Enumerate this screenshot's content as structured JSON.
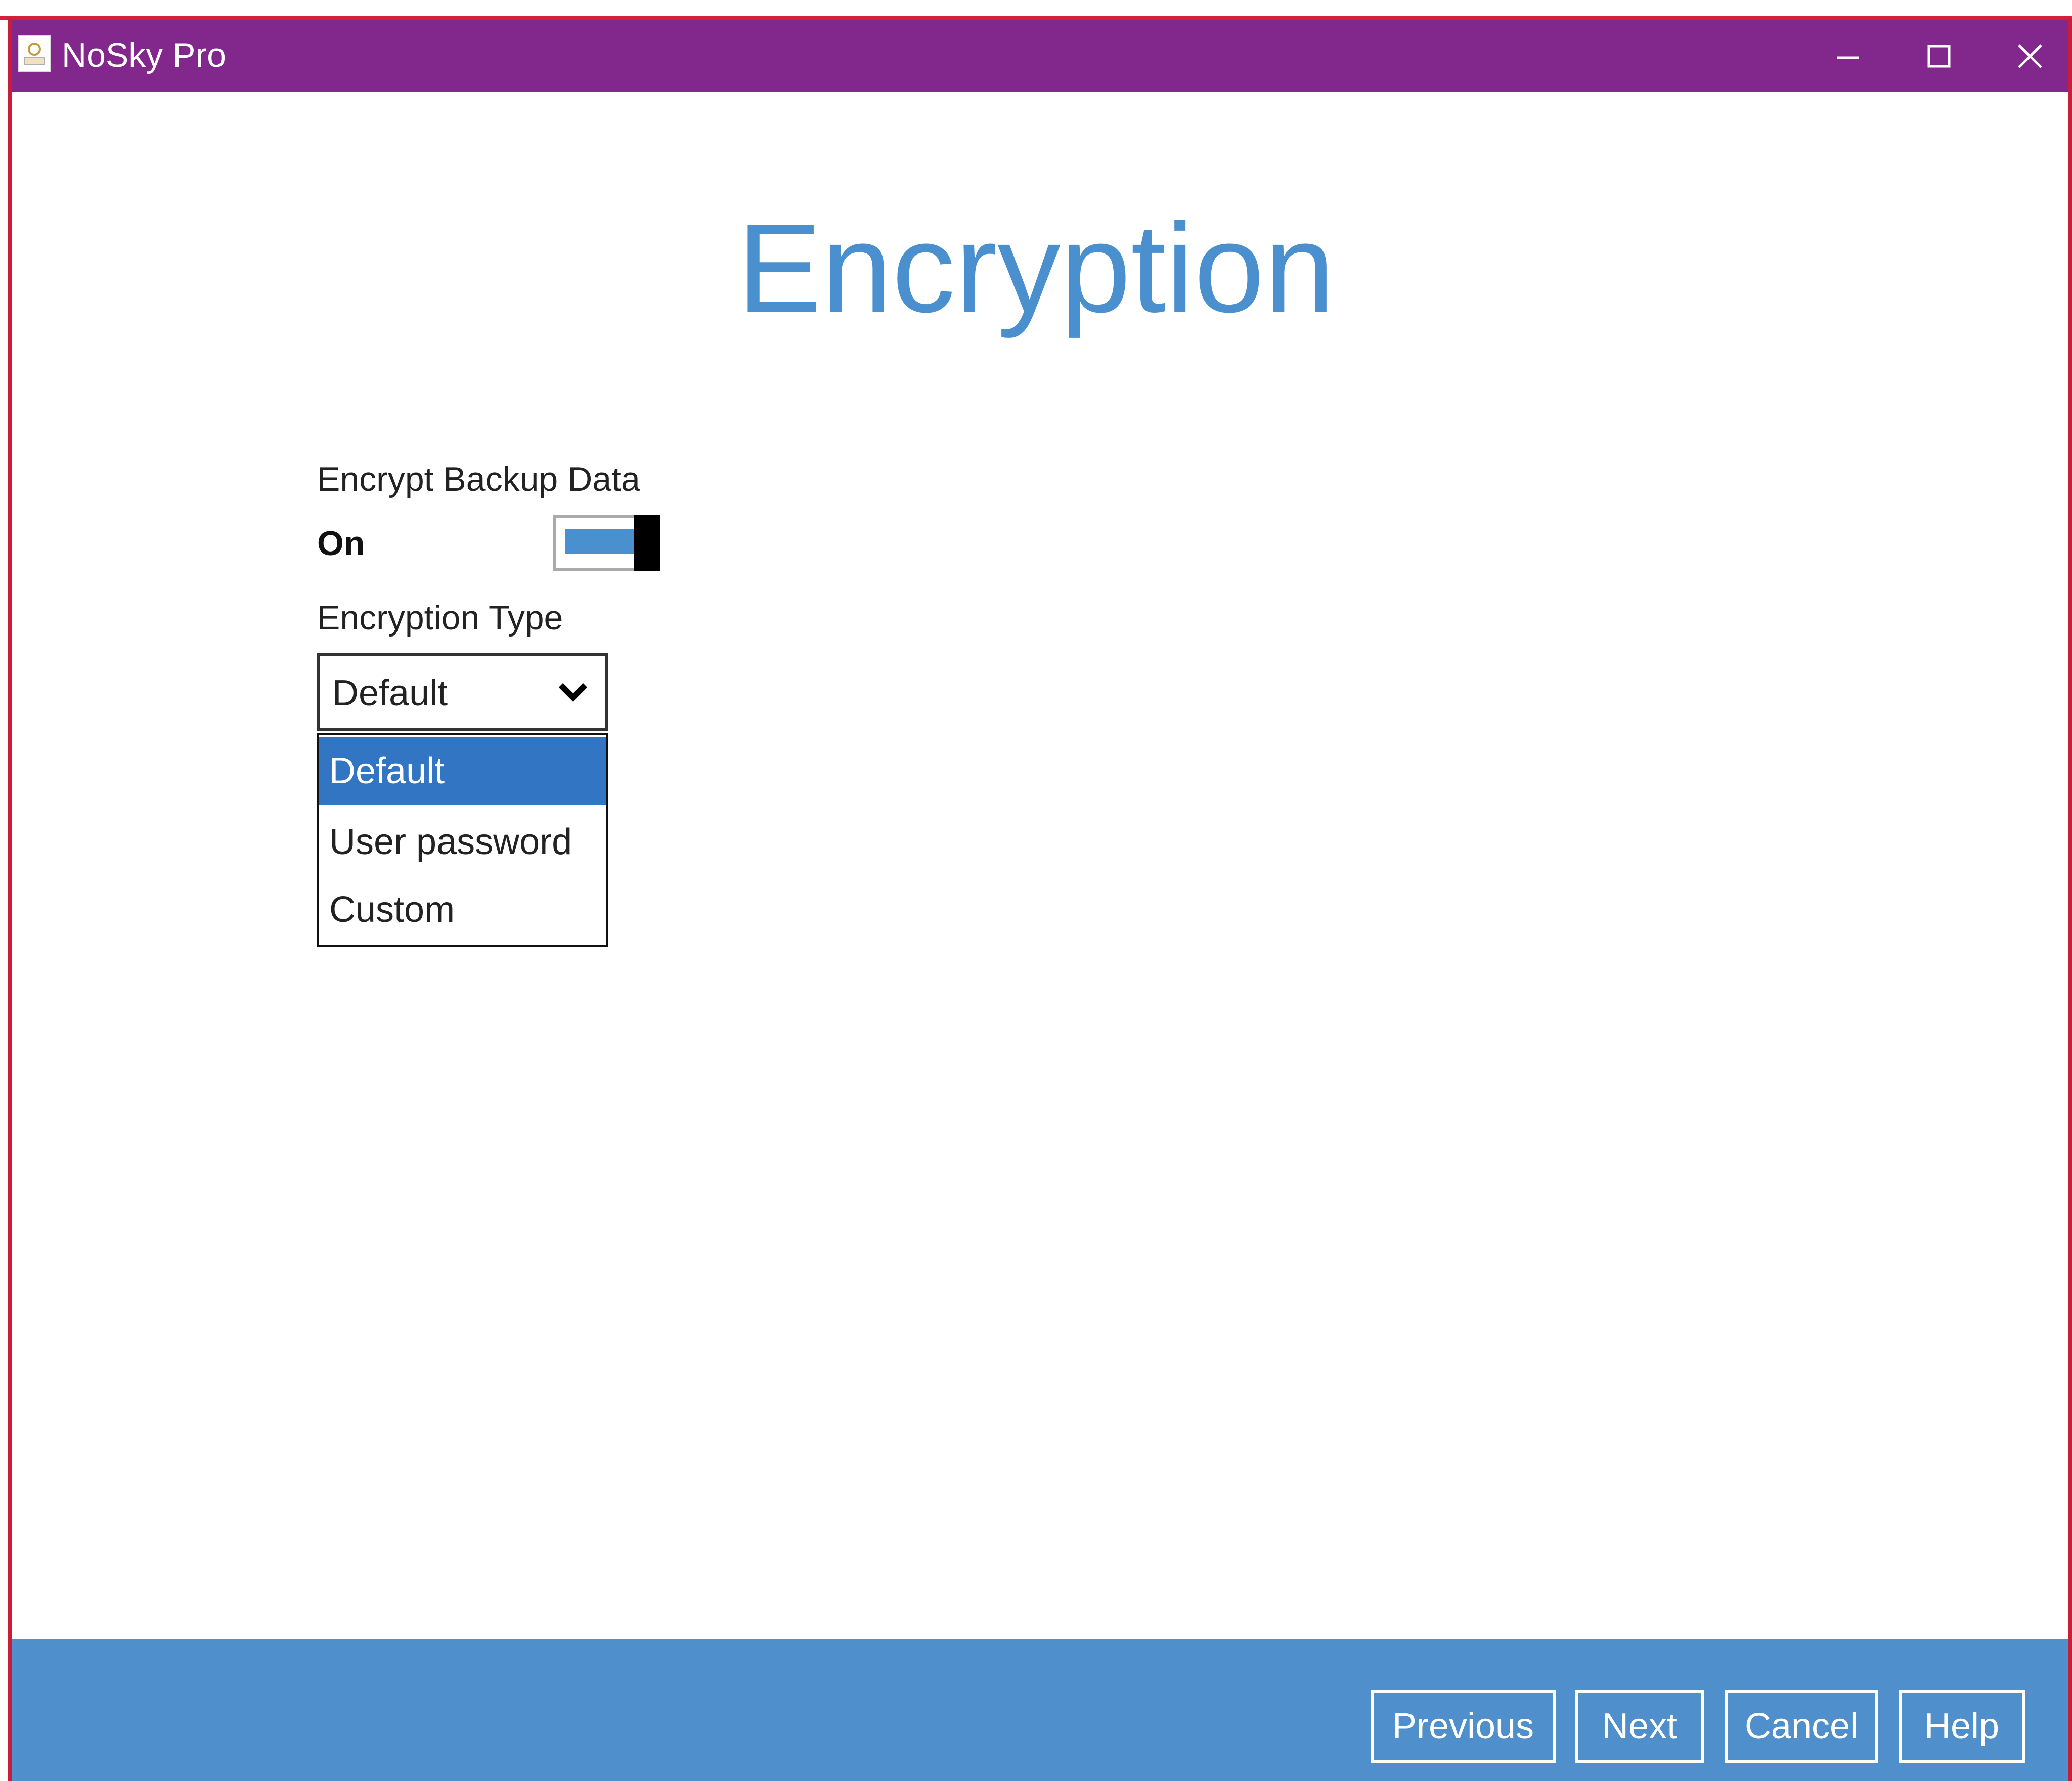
{
  "window": {
    "title": "NoSky Pro",
    "icon": "app-logo-icon",
    "controls": [
      "minimize-icon",
      "maximize-icon",
      "close-icon"
    ]
  },
  "main": {
    "heading": "Encryption",
    "encrypt_backup": {
      "label": "Encrypt Backup Data",
      "state_label": "On",
      "enabled": true
    },
    "encryption_type": {
      "label": "Encryption Type",
      "selected": "Default",
      "options": [
        "Default",
        "User password",
        "Custom"
      ],
      "highlighted_index": 0
    }
  },
  "footer": {
    "previous_label": "Previous",
    "next_label": "Next",
    "cancel_label": "Cancel",
    "help_label": "Help"
  },
  "colors": {
    "titlebar": "#82288c",
    "accent": "#4a8fce",
    "footer": "#4f8fcc",
    "selected_option": "#3276c3",
    "frame": "#c81e3c"
  }
}
